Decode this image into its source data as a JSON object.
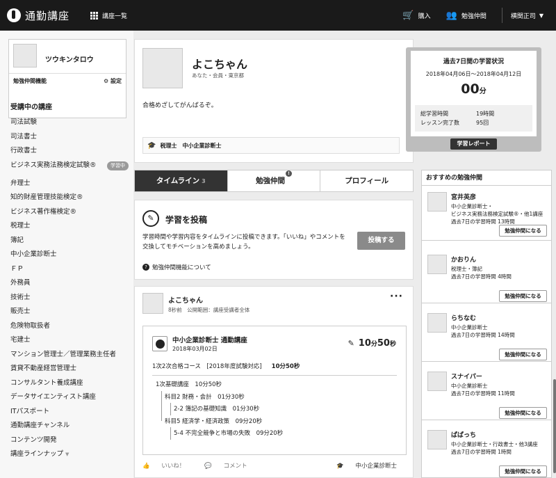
{
  "header": {
    "logo_text": "通勤講座",
    "courses_label": "講座一覧",
    "buy_label": "購入",
    "study_buddy_label": "勉強仲間",
    "user_name": "横関正司"
  },
  "sidebar": {
    "profile_name": "ツウキンタロウ",
    "buddy_feature": "勉強仲間機能",
    "settings": "設定",
    "section_title": "受講中の講座",
    "badge": "学習中",
    "items": [
      "司法試験",
      "司法書士",
      "行政書士",
      "ビジネス実務法務検定試験®",
      "弁理士",
      "知的財産管理技能検定®",
      "ビジネス著作権検定®",
      "税理士",
      "簿記",
      "中小企業診断士",
      "ＦＰ",
      "外務員",
      "技術士",
      "販売士",
      "危険物取扱者",
      "宅建士",
      "マンション管理士／管理業務主任者",
      "賃貸不動産経営管理士",
      "コンサルタント養成講座",
      "データサイエンティスト講座",
      "ITパスポート",
      "通勤講座チャンネル",
      "コンテンツ開発",
      "講座ラインナップ"
    ]
  },
  "profile": {
    "name": "よこちゃん",
    "subtitle": "あなた・会員・東京都",
    "message": "合格めざしてがんばるぞ。",
    "tags": "税理士　中小企業診断士"
  },
  "stats": {
    "title": "過去7日間の学習状況",
    "range": "2018年04月06日〜2018年04月12日",
    "total_value": "00",
    "total_unit": "分",
    "rows": [
      {
        "label": "総学習時間",
        "value": "19時間"
      },
      {
        "label": "レッスン完了数",
        "value": "95回"
      }
    ],
    "report_button": "学習レポート"
  },
  "tabs": [
    {
      "label": "タイムライン",
      "count": "3"
    },
    {
      "label": "勉強仲間",
      "notice": "!"
    },
    {
      "label": "プロフィール"
    }
  ],
  "post": {
    "title": "学習を投稿",
    "desc": "学習時間や学習内容をタイムラインに投稿できます。「いいね」やコメントを交換してモチベーションを高めましょう。",
    "button": "投稿する",
    "help": "勉強仲間機能について"
  },
  "feed": {
    "name": "よこちゃん",
    "meta": "8秒前　公開範囲：講座受講者全体",
    "card": {
      "title": "中小企業診断士 通勤講座",
      "date": "2018年03月02日",
      "time_value": "10",
      "time_unit1": "分",
      "time_value2": "50",
      "time_unit2": "秒",
      "course": "1次2次合格コース　[2018年度試験対応]",
      "course_time": "10分50秒",
      "tree": [
        "1次基礎講座　10分50秒",
        "科目2 財務・会計　01分30秒",
        "2-2 簿記の基礎知識　01分30秒",
        "科目5 経済学・経済政策　09分20秒",
        "5-4 不完全競争と市場の失敗　09分20秒"
      ]
    },
    "like": "いいね！",
    "comment": "コメント",
    "tag": "中小企業診断士"
  },
  "recommend": {
    "title": "おすすめの勉強仲間",
    "button": "勉強仲間になる",
    "items": [
      {
        "name": "宮井英彦",
        "sub1": "中小企業診断士・",
        "sub2": "ビジネス実務法務検定試験®・他1講座",
        "sub3": "過去7日の学習時間 13時間"
      },
      {
        "name": "かおりん",
        "sub1": "税理士・簿記",
        "sub2": "過去7日の学習時間 4時間",
        "sub3": ""
      },
      {
        "name": "らちなむ",
        "sub1": "中小企業診断士",
        "sub2": "過去7日の学習時間 14時間",
        "sub3": ""
      },
      {
        "name": "スナイパー",
        "sub1": "中小企業診断士",
        "sub2": "過去7日の学習時間 11時間",
        "sub3": ""
      },
      {
        "name": "ぱぱっち",
        "sub1": "中小企業診断士・行政書士・他3講座",
        "sub2": "過去7日の学習時間 1時間",
        "sub3": ""
      }
    ]
  }
}
